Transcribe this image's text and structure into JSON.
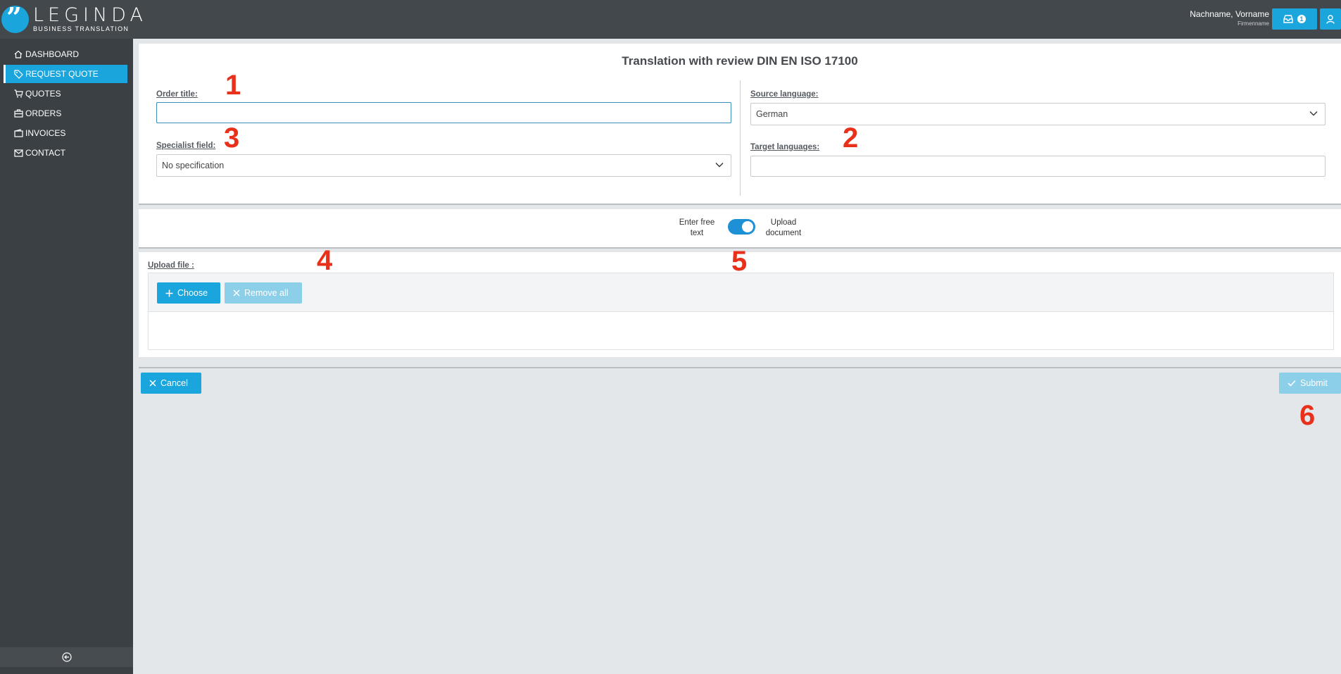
{
  "logo": {
    "name": "LEGINDA",
    "tagline": "BUSINESS TRANSLATION"
  },
  "user": {
    "name": "Nachname, Vorname",
    "company": "Firmenname",
    "inbox_count": "1"
  },
  "sidebar": {
    "items": [
      {
        "label": "DASHBOARD",
        "icon": "home-icon"
      },
      {
        "label": "REQUEST QUOTE",
        "icon": "tag-icon",
        "active": true
      },
      {
        "label": "QUOTES",
        "icon": "cart-icon"
      },
      {
        "label": "ORDERS",
        "icon": "briefcase-icon"
      },
      {
        "label": "INVOICES",
        "icon": "wallet-icon"
      },
      {
        "label": "CONTACT",
        "icon": "envelope-icon"
      }
    ]
  },
  "form": {
    "title": "Translation with review DIN EN ISO 17100",
    "order_title": {
      "label": "Order title:",
      "value": ""
    },
    "specialist_field": {
      "label": "Specialist field:",
      "value": "No specification"
    },
    "source_language": {
      "label": "Source language:",
      "value": "German"
    },
    "target_languages": {
      "label": "Target languages:",
      "value": ""
    }
  },
  "toggle": {
    "left_label": "Enter free text",
    "right_label": "Upload document",
    "state": "upload"
  },
  "upload": {
    "label": "Upload file :",
    "choose_label": "Choose",
    "remove_all_label": "Remove all"
  },
  "actions": {
    "cancel_label": "Cancel",
    "submit_label": "Submit"
  },
  "markers": [
    "1",
    "2",
    "3",
    "4",
    "5",
    "6"
  ],
  "colors": {
    "accent": "#1aa5dc",
    "topbar": "#43484d",
    "sidebar": "#3b4045",
    "marker": "#e8301a"
  }
}
